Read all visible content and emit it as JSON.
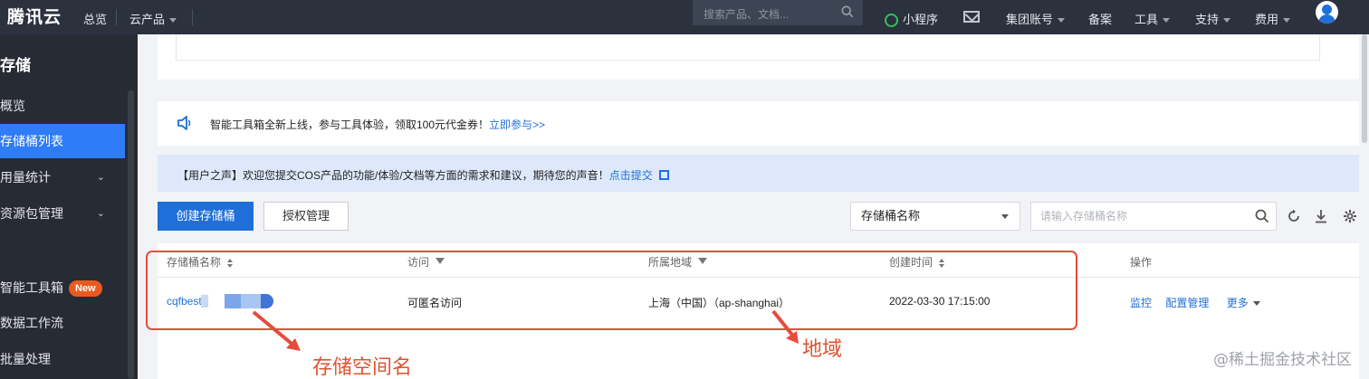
{
  "topbar": {
    "logo": "腾讯云",
    "nav_overview": "总览",
    "nav_products": "云产品",
    "search_placeholder": "搜索产品、文档...",
    "miniprogram": "小程序",
    "group_account": "集团账号",
    "beian": "备案",
    "tools": "工具",
    "support": "支持",
    "billing": "费用"
  },
  "sidebar": {
    "title": "存储",
    "items": [
      {
        "label": "概览"
      },
      {
        "label": "存储桶列表"
      },
      {
        "label": "用量统计"
      },
      {
        "label": "资源包管理"
      },
      {
        "label": "智能工具箱",
        "badge": "New"
      },
      {
        "label": "数据工作流"
      },
      {
        "label": "批量处理"
      }
    ]
  },
  "promo": {
    "text": "智能工具箱全新上线，参与工具体验，领取100元代金券！",
    "link": "立即参与>>"
  },
  "voice": {
    "text": "【用户之声】欢迎您提交COS产品的功能/体验/文档等方面的需求和建议，期待您的声音！",
    "link": "点击提交"
  },
  "toolbar": {
    "create_label": "创建存储桶",
    "auth_label": "授权管理",
    "select_value": "存储桶名称",
    "search_placeholder": "请输入存储桶名称"
  },
  "table": {
    "headers": {
      "name": "存储桶名称",
      "access": "访问",
      "region": "所属地域",
      "created": "创建时间",
      "actions": "操作"
    },
    "row": {
      "name": "cqfbest",
      "access": "可匿名访问",
      "region": "上海（中国）（ap-shanghai）",
      "created": "2022-03-30 17:15:00",
      "action_monitor": "监控",
      "action_config": "配置管理",
      "action_more": "更多"
    }
  },
  "annotations": {
    "bucket_name": "存储空间名",
    "region": "地域"
  },
  "watermark": "@稀土掘金技术社区",
  "colors": {
    "accent": "#1f6fd9",
    "topbar": "#2b313d",
    "sidebar": "#272b34",
    "annotation": "#e64c3c"
  }
}
